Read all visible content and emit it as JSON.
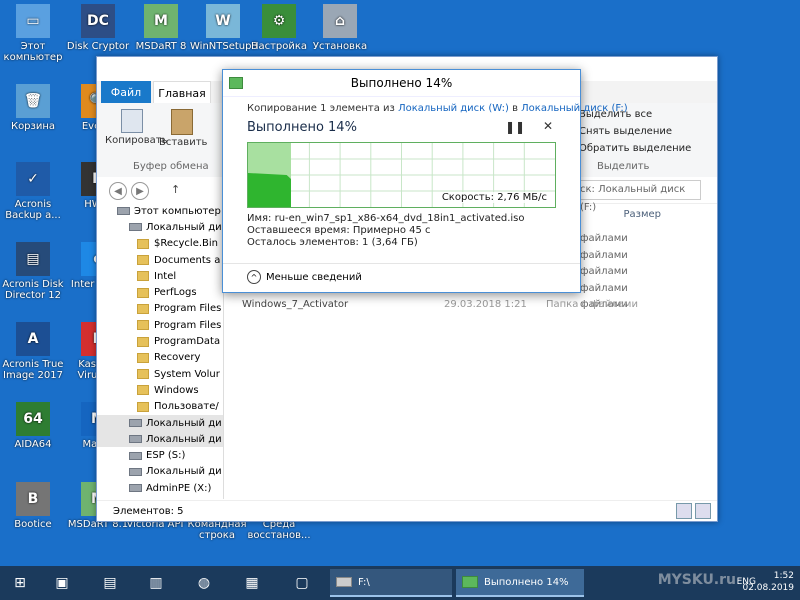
{
  "desktop": {
    "icons": [
      {
        "label": "Этот компьютер",
        "glyph": "▭",
        "color": "#5aa0e0"
      },
      {
        "label": "Disk Cryptor",
        "glyph": "DC",
        "color": "#2d4e86"
      },
      {
        "label": "MSDaRT 8",
        "glyph": "M",
        "color": "#6fb36f"
      },
      {
        "label": "WinNTSetup3",
        "glyph": "W",
        "color": "#7ab7d8"
      },
      {
        "label": "Настройка",
        "glyph": "⚙",
        "color": "#3a8e3a"
      },
      {
        "label": "Установка",
        "glyph": "⌂",
        "color": "#9aa7b5"
      },
      {
        "label": "Корзина",
        "glyph": "🗑",
        "color": "#5a9fd4"
      },
      {
        "label": "Everyt",
        "glyph": "🔍",
        "color": "#e08a1e"
      },
      {
        "label": "Acronis Backup a...",
        "glyph": "✓",
        "color": "#1f5ba8"
      },
      {
        "label": "HWiN",
        "glyph": "H",
        "color": "#333333"
      },
      {
        "label": "Acronis Disk Director 12",
        "glyph": "▤",
        "color": "#264b7a"
      },
      {
        "label": "Inter Explo",
        "glyph": "e",
        "color": "#1e88e5"
      },
      {
        "label": "Acronis True Image 2017",
        "glyph": "A",
        "color": "#1c4f94"
      },
      {
        "label": "Kaspers Virus Re",
        "glyph": "K",
        "color": "#d32f2f"
      },
      {
        "label": "AIDA64",
        "glyph": "64",
        "color": "#2e7d32"
      },
      {
        "label": "Maxth",
        "glyph": "M",
        "color": "#1565c0"
      },
      {
        "label": "Bootice",
        "glyph": "B",
        "color": "#757575"
      },
      {
        "label": "MSDaRT 8.1",
        "glyph": "M",
        "color": "#6fb36f"
      },
      {
        "label": "Victoria API",
        "glyph": "V",
        "color": "#455a64"
      },
      {
        "label": "Командная строка",
        "glyph": ">_",
        "color": "#111111"
      },
      {
        "label": "Среда восстанов...",
        "glyph": "⚙",
        "color": "#8d6e63"
      }
    ]
  },
  "explorer": {
    "tabs": {
      "file": "Файл",
      "home": "Главная"
    },
    "ribbon": {
      "copy": "Копировать",
      "paste": "Вставить",
      "clipboard_group": "Буфер обмена",
      "select_all": "Выделить все",
      "deselect": "Снять выделение",
      "invert": "Обратить выделение",
      "select_group": "Выделить"
    },
    "search_placeholder": "ск: Локальный диск (F:)",
    "tree": [
      {
        "label": "Этот компьютер",
        "kind": "pc"
      },
      {
        "label": "Локальный ди",
        "kind": "disk"
      },
      {
        "label": "$Recycle.Bin",
        "kind": "folder"
      },
      {
        "label": "Documents a",
        "kind": "folder"
      },
      {
        "label": "Intel",
        "kind": "folder"
      },
      {
        "label": "PerfLogs",
        "kind": "folder"
      },
      {
        "label": "Program Files",
        "kind": "folder"
      },
      {
        "label": "Program Files",
        "kind": "folder"
      },
      {
        "label": "ProgramData",
        "kind": "folder"
      },
      {
        "label": "Recovery",
        "kind": "folder"
      },
      {
        "label": "System Volur",
        "kind": "folder"
      },
      {
        "label": "Windows",
        "kind": "folder"
      },
      {
        "label": "Пользовате/",
        "kind": "folder"
      },
      {
        "label": "Локальный ди",
        "kind": "disk"
      },
      {
        "label": "Локальный ди",
        "kind": "disk"
      },
      {
        "label": "ESP (S:)",
        "kind": "disk"
      },
      {
        "label": "Локальный ди",
        "kind": "disk"
      },
      {
        "label": "AdminPE (X:)",
        "kind": "disk"
      }
    ],
    "columns": {
      "size": "Размер"
    },
    "file_types": [
      "файлами",
      "файлами",
      "файлами",
      "файлами",
      "файлами"
    ],
    "partial_row": {
      "name": "Windows_7_Activator",
      "date": "29.03.2018 1:21",
      "type": "Папка с файлами"
    },
    "status": "Элементов: 5"
  },
  "copy_dialog": {
    "title": "Выполнено 14%",
    "source_prefix": "Копирование 1 элемента из",
    "source_link": "Локальный диск (W:)",
    "dest_sep": "в",
    "dest_link": "Локальный диск (F:)",
    "progress_heading": "Выполнено 14%",
    "progress": 0.14,
    "speed": "Скорость: 2,76 МБ/с",
    "name_line": "Имя: ru-en_win7_sp1_x86-x64_dvd_18in1_activated.iso",
    "remaining_time": "Оставшееся время: Примерно 45 с",
    "remaining_items": "Осталось элементов: 1 (3,64 ГБ)",
    "less_details": "Меньше сведений",
    "pause_icon": "pause-icon",
    "close_icon": "close-icon",
    "graph_color": "#2fb52f"
  },
  "taskbar": {
    "explorer_item": "F:\\",
    "copy_item": "Выполнено 14%",
    "time": "1:52",
    "date": "02.08.2019",
    "lang": "ENG",
    "watermark": "MYSKU.ru"
  }
}
